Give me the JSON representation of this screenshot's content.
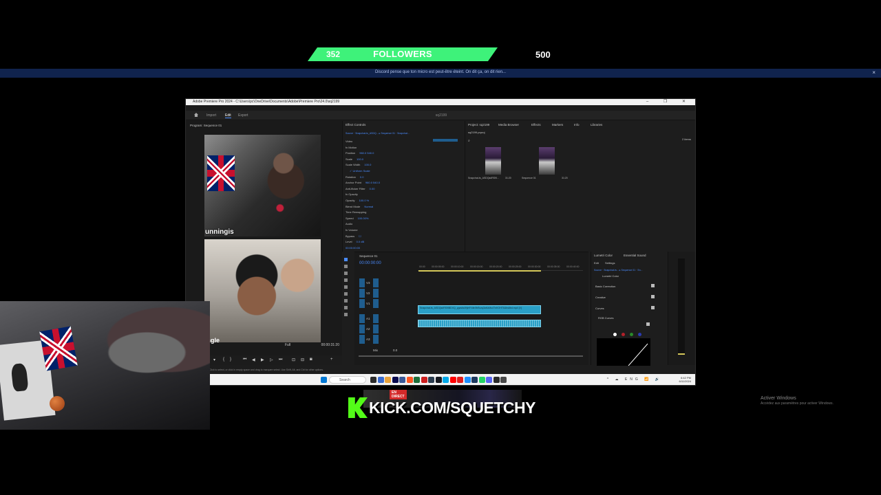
{
  "overlay": {
    "followers": {
      "current": "352",
      "label": "FOLLOWERS",
      "goal": "500",
      "progress": 0.704,
      "bar_color": "#3ef27a"
    },
    "ticker": {
      "text": "Discord pense que ton micro est peut-être éteint. On dit ça, on dit rien...",
      "close": "×"
    },
    "kick": {
      "url": "KICK.COM/SQUETCHY",
      "live_badge": "EN DIRECT",
      "brand_color": "#53fc18"
    },
    "activation": {
      "title": "Activer Windows",
      "subtitle": "Accédez aux paramètres pour activer Windows."
    }
  },
  "premiere": {
    "title": "Adobe Premiere Pro 2024 - C:\\Users\\pc\\OneDrive\\Documents\\Adobe\\Premiere Pro\\24.0\\sq2199",
    "window_controls": "– ❐ ✕",
    "menus": [
      "File",
      "Edit",
      "Clip",
      "Sequence",
      "Markers",
      "Graphics and Titles",
      "View",
      "Window",
      "Help"
    ],
    "workspace_tabs": [
      "Import",
      "Edit",
      "Export"
    ],
    "active_tab": "Edit",
    "project_name": "sq2199",
    "program": {
      "label": "Program: Sequence 01",
      "caption1": "unningis",
      "caption2": "ingle",
      "fit": "Full",
      "timecode": "00:00:31:20"
    },
    "effect_controls": {
      "label": "Effect Controls",
      "source": "Source · Snapchat-ts_ASDQ... ▸ Sequence 01 · Snapchat...",
      "rows": [
        {
          "name": "Video",
          "value": ""
        },
        {
          "name": "fx  Motion",
          "value": ""
        },
        {
          "name": "Position",
          "value": "960.0   540.0"
        },
        {
          "name": "Scale",
          "value": "100.0"
        },
        {
          "name": "Scale Width",
          "value": "100.0"
        },
        {
          "name": "",
          "value": "✓ Uniform Scale"
        },
        {
          "name": "Rotation",
          "value": "0.0"
        },
        {
          "name": "Anchor Point",
          "value": "960.0   540.0"
        },
        {
          "name": "Anti-flicker Filter",
          "value": "0.00"
        },
        {
          "name": "fx  Opacity",
          "value": ""
        },
        {
          "name": "Opacity",
          "value": "100.0 %"
        },
        {
          "name": "Blend Mode",
          "value": "Normal"
        },
        {
          "name": "Time Remapping",
          "value": ""
        },
        {
          "name": "Speed",
          "value": "100.00%"
        },
        {
          "name": "Audio",
          "value": ""
        },
        {
          "name": "fx  Volume",
          "value": ""
        },
        {
          "name": "Bypass",
          "value": "☐"
        },
        {
          "name": "Level",
          "value": "0.0 dB"
        }
      ],
      "timecode": "00:00:00:00"
    },
    "project": {
      "tabs": [
        "Project: sq2199",
        "Media Browser",
        "Effects",
        "Markers",
        "Info",
        "Libraries"
      ],
      "file": "sq2199.prproj",
      "count": "2 items",
      "items": [
        {
          "name": "Snapchat-ts_ASDQsdRS9l...",
          "duration": "31:20"
        },
        {
          "name": "Sequence 01",
          "duration": "31:20"
        }
      ]
    },
    "timeline": {
      "label": "Sequence 01",
      "timecode": "00:00:00:00",
      "ruler": [
        "00:00",
        "00:00:05:00",
        "00:00:10:00",
        "00:00:15:00",
        "00:00:20:00",
        "00:00:25:00",
        "00:00:30:00",
        "00:00:35:00",
        "00:00:40:00",
        "00:00:45:00"
      ],
      "tracks": [
        "V3",
        "V2",
        "V1",
        "A1",
        "A2",
        "A3",
        "Mix"
      ],
      "video_clip": "Snapchat-ts_ASDQsdRS9lBDXQ_ygasfa4Hje9Ydtn9hBvzq3w6zMu4TnKOHT6Ubs6bd.mp4 [V]",
      "mix": "0.0"
    },
    "lumetri": {
      "tabs": [
        "Lumetri Color",
        "Essential Sound"
      ],
      "sub_tabs": [
        "Edit",
        "Settings"
      ],
      "source": "Source · Snapchat-ts... ▸ Sequence 01 · Sn...",
      "preset": "Lumetri Color",
      "sections": [
        "Basic Correction",
        "Creative",
        "Curves",
        "RGB Curves"
      ]
    },
    "status": "Click to select, or click in empty space and drag to marquee select. Use Shift, Alt, and Ctrl for other options.",
    "taskbar": {
      "search": "Search",
      "tray": "^ ☁ ENG 📶 🔊",
      "time": "6:42 PM",
      "date": "6/11/2024",
      "icon_colors": [
        "#0078d4",
        "#2d2d2d",
        "#3b6ccf",
        "#e8a33d",
        "#0b0b4f",
        "#3b5998",
        "#ff5722",
        "#1e6e3a",
        "#cc1f1f",
        "#2c3e50",
        "#171a21",
        "#00a8e8",
        "#ff0000",
        "#e21d1d",
        "#1e90ff",
        "#1f3a5f",
        "#25d366",
        "#5865f2",
        "#2b2b2b",
        "#4a4a4a"
      ]
    }
  }
}
